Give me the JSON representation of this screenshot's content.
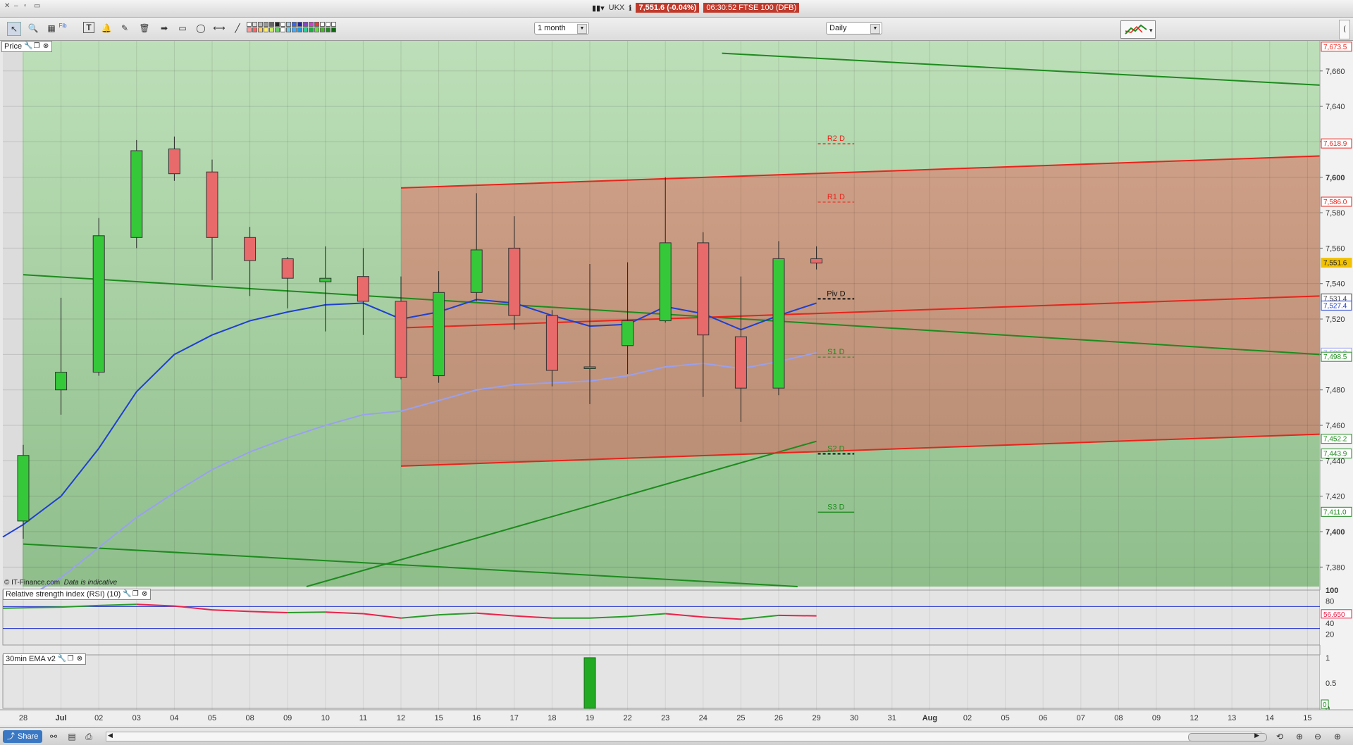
{
  "window": {
    "ticker_symbol": "UKX",
    "price_badge": "7,551.6 (-0.04%)",
    "clock_title": "06:30:52 FTSE 100 (DFB)"
  },
  "toolbar": {
    "period": "1 month",
    "interval": "Daily"
  },
  "panels": {
    "price_label": "Price",
    "copyright": "© IT-Finance.com",
    "indicative": "Data is indicative",
    "rsi_label": "Relative strength index (RSI) (10)",
    "ema_label": "30min EMA v2"
  },
  "bottom": {
    "share_label": "Share"
  },
  "colors": {
    "candle_up": "#35c93a",
    "candle_down": "#e86a6a",
    "channel_red": "#e8231b",
    "channel_green": "#1e8a1e",
    "ma_dark": "#1f3fd0",
    "ma_light": "#9aa0f0",
    "bg_green": "#b7d9b4",
    "bg_brown": "#c9957e"
  },
  "chart_data": {
    "type": "candlestick",
    "x_labels": [
      "28",
      "Jul",
      "02",
      "03",
      "04",
      "05",
      "08",
      "09",
      "10",
      "11",
      "12",
      "15",
      "16",
      "17",
      "18",
      "19",
      "22",
      "23",
      "24",
      "25",
      "26",
      "29",
      "30",
      "31",
      "Aug",
      "02",
      "05",
      "06",
      "07",
      "08",
      "09",
      "12",
      "13",
      "14",
      "15"
    ],
    "y_ticks": [
      7380,
      7400,
      7420,
      7440,
      7460,
      7480,
      7500,
      7520,
      7540,
      7560,
      7580,
      7600,
      7620,
      7640,
      7660
    ],
    "y_tick_labels": [
      "7,380",
      "7,400",
      "7,420",
      "7,440",
      "7,460",
      "7,480",
      "7,500",
      "7,520",
      "7,540",
      "7,560",
      "7,580",
      "7,600",
      "7,620",
      "7,640",
      "7,660"
    ],
    "ylim": [
      7369,
      7677
    ],
    "candles": [
      {
        "o": 7406,
        "h": 7449,
        "l": 7396,
        "c": 7443
      },
      {
        "o": 7480,
        "h": 7532,
        "l": 7466,
        "c": 7490
      },
      {
        "o": 7490,
        "h": 7577,
        "l": 7488,
        "c": 7567
      },
      {
        "o": 7566,
        "h": 7621,
        "l": 7560,
        "c": 7615
      },
      {
        "o": 7616,
        "h": 7623,
        "l": 7598,
        "c": 7602
      },
      {
        "o": 7603,
        "h": 7610,
        "l": 7542,
        "c": 7566
      },
      {
        "o": 7566,
        "h": 7572,
        "l": 7533,
        "c": 7553
      },
      {
        "o": 7554,
        "h": 7555,
        "l": 7526,
        "c": 7543
      },
      {
        "o": 7541,
        "h": 7561,
        "l": 7513,
        "c": 7543
      },
      {
        "o": 7544,
        "h": 7560,
        "l": 7511,
        "c": 7530
      },
      {
        "o": 7530,
        "h": 7544,
        "l": 7486,
        "c": 7487
      },
      {
        "o": 7488,
        "h": 7547,
        "l": 7484,
        "c": 7535
      },
      {
        "o": 7535,
        "h": 7591,
        "l": 7530,
        "c": 7559
      },
      {
        "o": 7560,
        "h": 7578,
        "l": 7514,
        "c": 7522
      },
      {
        "o": 7522,
        "h": 7525,
        "l": 7482,
        "c": 7491
      },
      {
        "o": 7492,
        "h": 7551,
        "l": 7472,
        "c": 7493
      },
      {
        "o": 7505,
        "h": 7552,
        "l": 7489,
        "c": 7519
      },
      {
        "o": 7519,
        "h": 7600,
        "l": 7518,
        "c": 7563
      },
      {
        "o": 7563,
        "h": 7569,
        "l": 7476,
        "c": 7511
      },
      {
        "o": 7510,
        "h": 7544,
        "l": 7462,
        "c": 7481
      },
      {
        "o": 7481,
        "h": 7564,
        "l": 7477,
        "c": 7554
      },
      {
        "o": 7554,
        "h": 7561,
        "l": 7548,
        "c": 7551.6
      }
    ],
    "ma_fast": [
      7404,
      7420,
      7447,
      7479,
      7500,
      7511,
      7519,
      7524,
      7528,
      7529,
      7520,
      7524,
      7531,
      7529,
      7522,
      7516,
      7517,
      7527,
      7523,
      7514,
      7522,
      7529
    ],
    "ma_slow": [
      7362,
      7374,
      7391,
      7408,
      7422,
      7435,
      7445,
      7453,
      7460,
      7466,
      7468,
      7474,
      7480,
      7483,
      7484,
      7485,
      7488,
      7493,
      7495,
      7492,
      7496,
      7501
    ],
    "pivots": [
      {
        "name": "R2 D",
        "value": 7618.9,
        "style": "red-dash"
      },
      {
        "name": "R1 D",
        "value": 7586.0,
        "style": "red-dash-thin"
      },
      {
        "name": "Piv D",
        "value": 7531.4,
        "style": "black-dash"
      },
      {
        "name": "S1 D",
        "value": 7498.5,
        "style": "green-dash-thin"
      },
      {
        "name": "S2 D",
        "value": 7443.9,
        "style": "black-dash"
      },
      {
        "name": "S3 D",
        "value": 7411.0,
        "style": "green-solid"
      }
    ],
    "right_badges": [
      {
        "label": "7,673.5",
        "value": 7673.5,
        "color": "#e8231b"
      },
      {
        "label": "7,618.9",
        "value": 7618.9,
        "color": "#e8231b"
      },
      {
        "label": "7,586.0",
        "value": 7586.0,
        "color": "#e8231b"
      },
      {
        "label": "7,551.6",
        "value": 7551.6,
        "color": "#f2c200"
      },
      {
        "label": "7,531.4",
        "value": 7531.4,
        "color": "#444444"
      },
      {
        "label": "7,527.4",
        "value": 7527.4,
        "color": "#1f3fd0"
      },
      {
        "label": "7,500.8",
        "value": 7500.8,
        "color": "#9aa0f0"
      },
      {
        "label": "7,498.5",
        "value": 7498.5,
        "color": "#1e8a1e"
      },
      {
        "label": "7,452.2",
        "value": 7452.2,
        "color": "#1e8a1e"
      },
      {
        "label": "7,443.9",
        "value": 7443.9,
        "color": "#1e8a1e"
      },
      {
        "label": "7,411.0",
        "value": 7411.0,
        "color": "#1e8a1e"
      }
    ],
    "channels": [
      {
        "name": "green-upper",
        "color": "#1e8a1e",
        "p1": {
          "x": 18.5,
          "y": 7670
        },
        "p2": {
          "x": 34.5,
          "y": 7652
        }
      },
      {
        "name": "green-mid",
        "color": "#1e8a1e",
        "p1": {
          "x": 0,
          "y": 7545
        },
        "p2": {
          "x": 34.5,
          "y": 7500
        }
      },
      {
        "name": "green-lower",
        "color": "#1e8a1e",
        "p1": {
          "x": 0,
          "y": 7393
        },
        "p2": {
          "x": 20.5,
          "y": 7369
        }
      },
      {
        "name": "green-rising",
        "color": "#1e8a1e",
        "p1": {
          "x": 7.5,
          "y": 7369
        },
        "p2": {
          "x": 21,
          "y": 7451
        }
      },
      {
        "name": "red-upper",
        "color": "#e8231b",
        "p1": {
          "x": 10,
          "y": 7594
        },
        "p2": {
          "x": 34.5,
          "y": 7612
        }
      },
      {
        "name": "red-mid",
        "color": "#e8231b",
        "p1": {
          "x": 10,
          "y": 7515
        },
        "p2": {
          "x": 34.5,
          "y": 7533
        }
      },
      {
        "name": "red-lower",
        "color": "#e8231b",
        "p1": {
          "x": 10,
          "y": 7437
        },
        "p2": {
          "x": 34.5,
          "y": 7455
        }
      }
    ],
    "rsi": {
      "values": [
        67,
        69,
        72,
        74,
        71,
        64,
        61,
        59,
        60,
        57,
        49,
        55,
        58,
        53,
        49,
        49,
        52,
        57,
        51,
        47,
        54,
        53
      ],
      "levels": [
        30,
        70
      ],
      "ticks": [
        "100",
        "80",
        "60",
        "40",
        "20"
      ],
      "last_label": "56.650"
    },
    "ema": {
      "bars": [
        {
          "x_index": 15,
          "value": 1
        }
      ],
      "ticks": [
        "1",
        "0.5",
        "0"
      ],
      "last_label": "0"
    }
  }
}
